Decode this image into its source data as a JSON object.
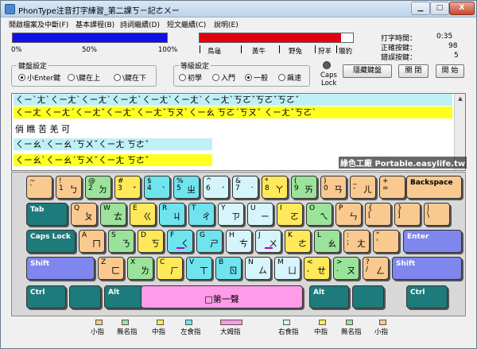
{
  "window": {
    "title": "PhonType注音打字練習_第二課ㄎㄧ記ㄜㄨー",
    "min_label": "▁",
    "max_label": "□",
    "close_label": "X"
  },
  "menu": [
    "開啟檔案及中斷(F)",
    "基本課程(B)",
    "詩詞繼續(D)",
    "短文繼續(C)",
    "說明(E)"
  ],
  "progress": {
    "blue_fraction": 1.0,
    "red_fraction": 0.92,
    "ticks": [
      "0%",
      "50%",
      "100%"
    ],
    "items": [
      "鳥龜",
      "黃牛",
      "野兔",
      "狩羊",
      "獵豹"
    ]
  },
  "stats": {
    "time_label": "打字時間：",
    "time_value": "0:35",
    "correct_label": "正確按鍵：",
    "correct_value": "98",
    "wrong_label": "錯誤按鍵：",
    "wrong_value": "5"
  },
  "keyboard_settings": {
    "title": "鍵盤設定",
    "options": [
      "小Enter鍵",
      "\\鍵在上",
      "\\鍵在下"
    ],
    "selected": 0
  },
  "level_settings": {
    "title": "等級設定",
    "options": [
      "初學",
      "入門",
      "一般",
      "飆速"
    ],
    "selected": 2
  },
  "caps_lock": {
    "line1": "Caps",
    "line2": "Lock"
  },
  "buttons": {
    "hide_keyboard": "隱藏鍵盤",
    "close": "關 閉",
    "start": "開 始"
  },
  "text_lines": [
    {
      "text": "ㄑㄧˋㄤˋㄑㄧㄤˋㄑㄧㄤˋㄑㄧㄤˋㄑㄧㄤˋㄑㄧㄤˋㄑㄧㄤˋㄎㄛˇㄎㄛˇㄎㄛˇ",
      "style": "cyan"
    },
    {
      "text": "ㄑㄧㄤ  ㄑㄧㄤˊㄑㄧㄤˇㄑㄧㄤˋㄑㄧㄤˇㄎㄡˋㄑㄧㄠ  ㄎㄛˊㄎㄡˇ   ㄑㄧㄤˇㄎㄛˋ",
      "style": "yellow"
    },
    {
      "text": "俏     瞧     苦    羌     可",
      "style": "plain"
    },
    {
      "text": "ㄑㄧㄠˋㄑㄧㄠˊㄎㄨˇㄑㄧㄤ   ㄎㄜˇ",
      "style": "cyan"
    },
    {
      "text": "ㄑㄧㄠˋㄑㄧㄠˊㄎㄨˇㄑㄧㄤ   ㄎㄜˇ",
      "style": "yellow"
    }
  ],
  "watermark": "綠色工廠 Portable.easylife.tw",
  "keys": {
    "row1": [
      {
        "main": "~\n`",
        "zh": "",
        "c": "k-or"
      },
      {
        "main": "!\n1",
        "zh": "ㄅ",
        "c": "k-or"
      },
      {
        "main": "@\n2",
        "zh": "ㄉ",
        "c": "k-gr"
      },
      {
        "main": "#\n3",
        "zh": "ˇ",
        "c": "k-ye"
      },
      {
        "main": "$\n4",
        "zh": "ˋ",
        "c": "k-cy"
      },
      {
        "main": "%\n5",
        "zh": "ㄓ",
        "c": "k-cy"
      },
      {
        "main": "^\n6",
        "zh": "ˊ",
        "c": "k-lc"
      },
      {
        "main": "&\n7",
        "zh": "˙",
        "c": "k-lc"
      },
      {
        "main": "*\n8",
        "zh": "ㄚ",
        "c": "k-ye"
      },
      {
        "main": "(\n9",
        "zh": "ㄞ",
        "c": "k-gr"
      },
      {
        "main": ")\n0",
        "zh": "ㄢ",
        "c": "k-or"
      },
      {
        "main": "_\n-",
        "zh": "ㄦ",
        "c": "k-or"
      },
      {
        "main": "+\n=",
        "zh": "",
        "c": "k-or"
      }
    ],
    "backspace": "Backspace",
    "row2": [
      {
        "main": "Q",
        "zh": "ㄆ",
        "c": "k-or"
      },
      {
        "main": "W",
        "zh": "ㄊ",
        "c": "k-gr"
      },
      {
        "main": "E",
        "zh": "ㄍ",
        "c": "k-ye"
      },
      {
        "main": "R",
        "zh": "ㄐ",
        "c": "k-cy"
      },
      {
        "main": "T",
        "zh": "ㄔ",
        "c": "k-cy"
      },
      {
        "main": "Y",
        "zh": "ㄗ",
        "c": "k-lc"
      },
      {
        "main": "U",
        "zh": "ㄧ",
        "c": "k-lc"
      },
      {
        "main": "I",
        "zh": "ㄛ",
        "c": "k-ye"
      },
      {
        "main": "O",
        "zh": "ㄟ",
        "c": "k-gr"
      },
      {
        "main": "P",
        "zh": "ㄣ",
        "c": "k-or"
      },
      {
        "main": "{\n[",
        "zh": "",
        "c": "k-or"
      },
      {
        "main": "}\n]",
        "zh": "",
        "c": "k-or"
      },
      {
        "main": "|\n\\",
        "zh": "",
        "c": "k-or"
      }
    ],
    "tab": "Tab",
    "row3": [
      {
        "main": "A",
        "zh": "ㄇ",
        "c": "k-or"
      },
      {
        "main": "S",
        "zh": "ㄋ",
        "c": "k-gr"
      },
      {
        "main": "D",
        "zh": "ㄎ",
        "c": "k-ye"
      },
      {
        "main": "F",
        "zh": "ㄑ",
        "c": "k-cy"
      },
      {
        "main": "G",
        "zh": "ㄕ",
        "c": "k-cy"
      },
      {
        "main": "H",
        "zh": "ㄘ",
        "c": "k-lc"
      },
      {
        "main": "J",
        "zh": "ㄨ",
        "c": "k-lc"
      },
      {
        "main": "K",
        "zh": "ㄜ",
        "c": "k-ye"
      },
      {
        "main": "L",
        "zh": "ㄠ",
        "c": "k-gr"
      },
      {
        "main": ":\n;",
        "zh": "ㄤ",
        "c": "k-or"
      },
      {
        "main": "\"\n'",
        "zh": "",
        "c": "k-or"
      }
    ],
    "capslock": "Caps Lock",
    "enter": "Enter",
    "row4": [
      {
        "main": "Z",
        "zh": "ㄈ",
        "c": "k-or"
      },
      {
        "main": "X",
        "zh": "ㄌ",
        "c": "k-gr"
      },
      {
        "main": "C",
        "zh": "ㄏ",
        "c": "k-ye"
      },
      {
        "main": "V",
        "zh": "ㄒ",
        "c": "k-cy"
      },
      {
        "main": "B",
        "zh": "ㄖ",
        "c": "k-cy"
      },
      {
        "main": "N",
        "zh": "ㄙ",
        "c": "k-lc"
      },
      {
        "main": "M",
        "zh": "ㄩ",
        "c": "k-lc"
      },
      {
        "main": "<\n,",
        "zh": "ㄝ",
        "c": "k-ye"
      },
      {
        "main": ">\n.",
        "zh": "ㄡ",
        "c": "k-gr"
      },
      {
        "main": "?\n/",
        "zh": "ㄥ",
        "c": "k-or"
      }
    ],
    "shift": "Shift",
    "ctrl": "Ctrl",
    "alt": "Alt",
    "space": "□第一聲"
  },
  "legend": [
    {
      "label": "小指",
      "color": "#f9c98f"
    },
    {
      "label": "無名指",
      "color": "#9be39b"
    },
    {
      "label": "中指",
      "color": "#ffe95a"
    },
    {
      "label": "左食指",
      "color": "#6fe4ee"
    },
    {
      "label": "大姆指",
      "color": "#ff9be8"
    },
    {
      "label": "右食指",
      "color": "#d6f4fb"
    },
    {
      "label": "中指",
      "color": "#ffe95a"
    },
    {
      "label": "無名指",
      "color": "#9be39b"
    },
    {
      "label": "小指",
      "color": "#f9c98f"
    }
  ]
}
